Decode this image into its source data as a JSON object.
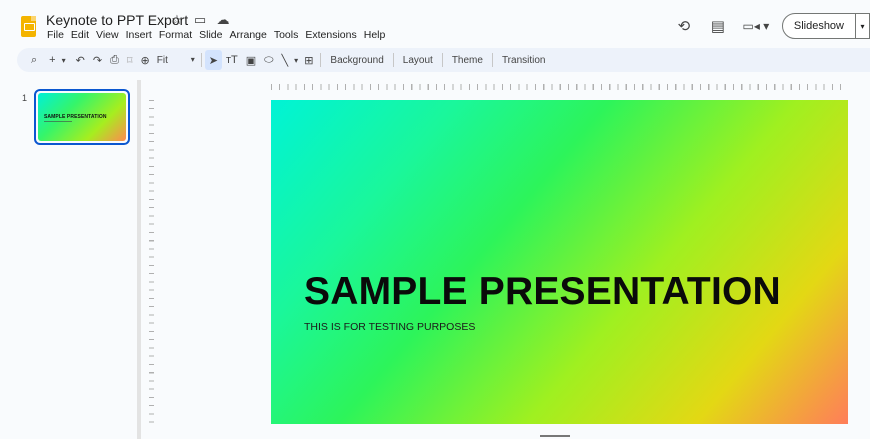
{
  "app": {
    "title": "Keynote to PPT Export",
    "menu": [
      "File",
      "Edit",
      "View",
      "Insert",
      "Format",
      "Slide",
      "Arrange",
      "Tools",
      "Extensions",
      "Help"
    ],
    "slideshow_label": "Slideshow"
  },
  "icons": {
    "star": "☆",
    "folder": "🗀",
    "cloud": "☁",
    "history": "⟲",
    "comments": "▤",
    "camera": "▭",
    "dropdown": "▾"
  },
  "toolbar": {
    "zoom_value": "Fit",
    "background_label": "Background",
    "layout_label": "Layout",
    "theme_label": "Theme",
    "transition_label": "Transition"
  },
  "filmstrip": {
    "slides": [
      {
        "number": "1",
        "title": "SAMPLE PRESENTATION"
      }
    ]
  },
  "slide": {
    "title": "SAMPLE PRESENTATION",
    "subtitle": "THIS IS FOR TESTING PURPOSES"
  },
  "colors": {
    "accent": "#0b57d0",
    "toolbar_bg": "#edf2fa",
    "logo": "#f4b400"
  }
}
